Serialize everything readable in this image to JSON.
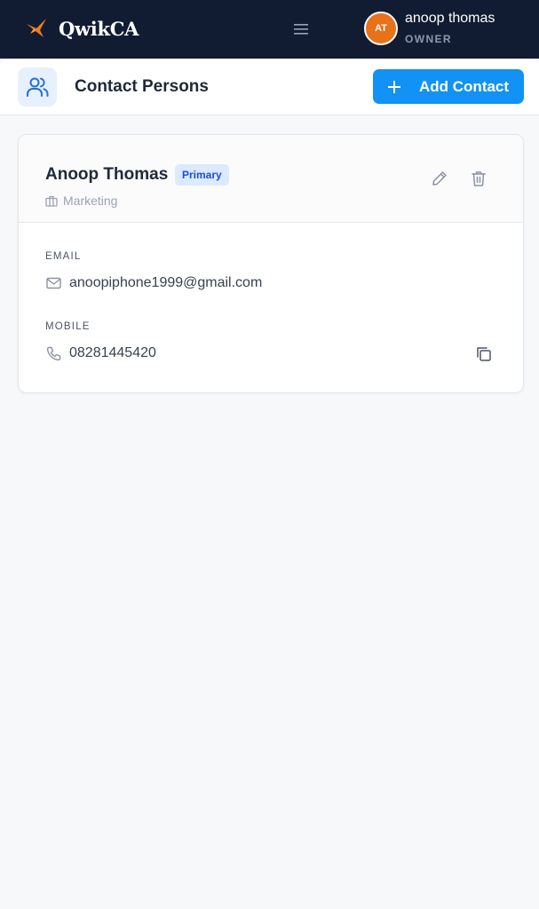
{
  "app": {
    "name": "QwikCA",
    "accent": "#f07d1a",
    "nav_bg": "#111c33"
  },
  "header": {
    "menu_icon": "hamburger-icon",
    "user": {
      "initials": "AT",
      "name": "anoop thomas",
      "role": "OWNER",
      "avatar_color": "#e8711a"
    }
  },
  "panel": {
    "icon": "users-icon",
    "title": "Contact Persons",
    "add_button": {
      "label": "Add Contact",
      "icon": "plus-icon",
      "color": "#1292f4"
    }
  },
  "contacts": [
    {
      "name": "Anoop Thomas",
      "badge": "Primary",
      "department": "Marketing",
      "department_icon": "briefcase-icon",
      "actions": [
        "edit-icon",
        "trash-icon"
      ],
      "email_label": "EMAIL",
      "email": "anoopiphone1999@gmail.com",
      "mobile_label": "MOBILE",
      "mobile": "08281445420",
      "copy_icon": "copy-icon"
    }
  ]
}
